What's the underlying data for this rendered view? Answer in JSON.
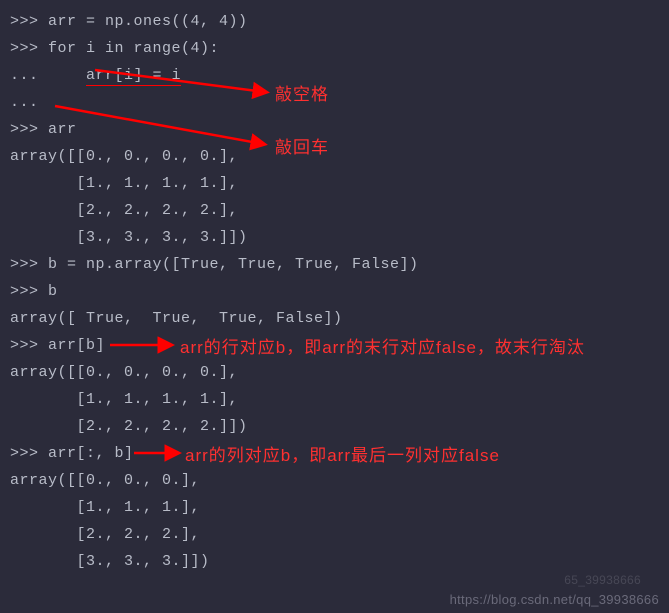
{
  "lines": {
    "l0": ">>> arr = np.ones((4, 4))",
    "l1": ">>> for i in range(4):",
    "l2a": "...     ",
    "l2b": "arr[i] = i",
    "l3": "...",
    "l4": ">>> arr",
    "l5": "array([[0., 0., 0., 0.],",
    "l6": "       [1., 1., 1., 1.],",
    "l7": "       [2., 2., 2., 2.],",
    "l8": "       [3., 3., 3., 3.]])",
    "l9": ">>> b = np.array([True, True, True, False])",
    "l10": ">>> b",
    "l11": "array([ True,  True,  True, False])",
    "l12": ">>> arr[b]",
    "l13": "array([[0., 0., 0., 0.],",
    "l14": "       [1., 1., 1., 1.],",
    "l15": "       [2., 2., 2., 2.]])",
    "l16": ">>> arr[:, b]",
    "l17": "array([[0., 0., 0.],",
    "l18": "       [1., 1., 1.],",
    "l19": "       [2., 2., 2.],",
    "l20": "       [3., 3., 3.]])"
  },
  "annos": {
    "a1": "敲空格",
    "a2": "敲回车",
    "a3": "arr的行对应b，即arr的末行对应false，故末行淘汰",
    "a4": "arr的列对应b，即arr最后一列对应false"
  },
  "water1": "https://blog.csdn.net/qq_39938666",
  "water2": "65_39938666"
}
